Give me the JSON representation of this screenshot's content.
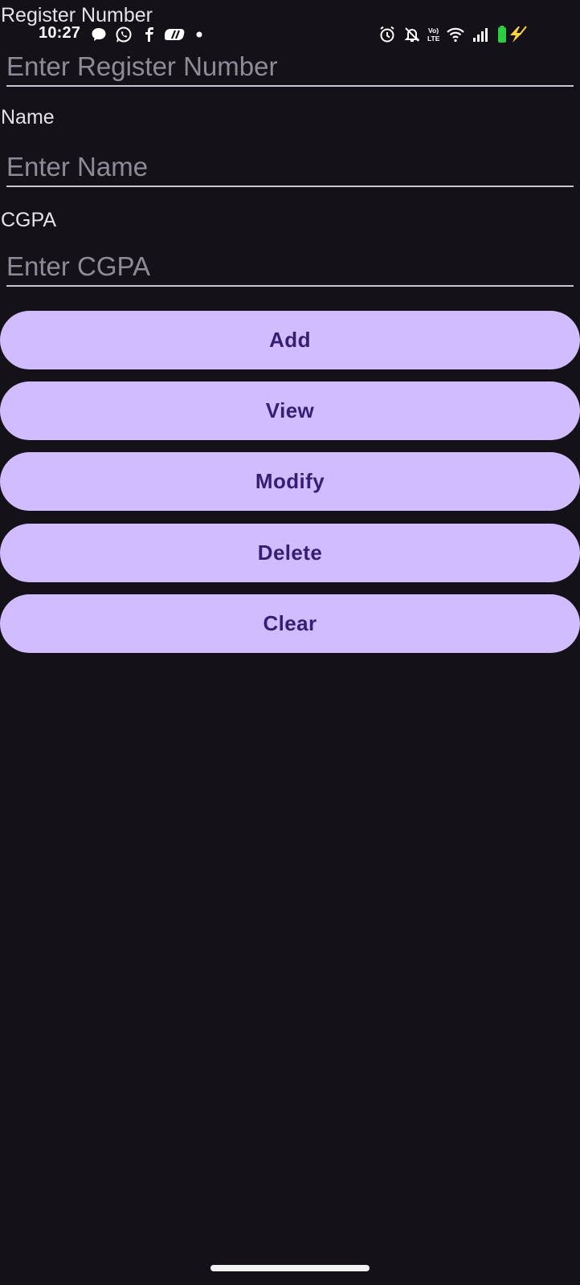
{
  "status_bar": {
    "time": "10:27",
    "left_icons": [
      "chat-bubble-icon",
      "whatsapp-icon",
      "fb-icon",
      "app-icon",
      "dot-icon"
    ],
    "right_icons": [
      "alarm-icon",
      "silent-bell-icon",
      "volte-icon",
      "wifi-icon",
      "signal-icon",
      "battery-charging-icon"
    ],
    "battery_color": "#2ecc40",
    "charging_color": "#ffd43b"
  },
  "form": {
    "register_label": "Register Number",
    "register_placeholder": "Enter Register Number",
    "name_label": "Name",
    "name_placeholder": "Enter Name",
    "cgpa_label": "CGPA",
    "cgpa_placeholder": "Enter CGPA"
  },
  "buttons": {
    "add": "Add",
    "view": "View",
    "modify": "Modify",
    "delete": "Delete",
    "clear": "Clear"
  },
  "colors": {
    "background": "#141218",
    "button_bg": "#d0bcff",
    "button_text": "#381e72"
  }
}
